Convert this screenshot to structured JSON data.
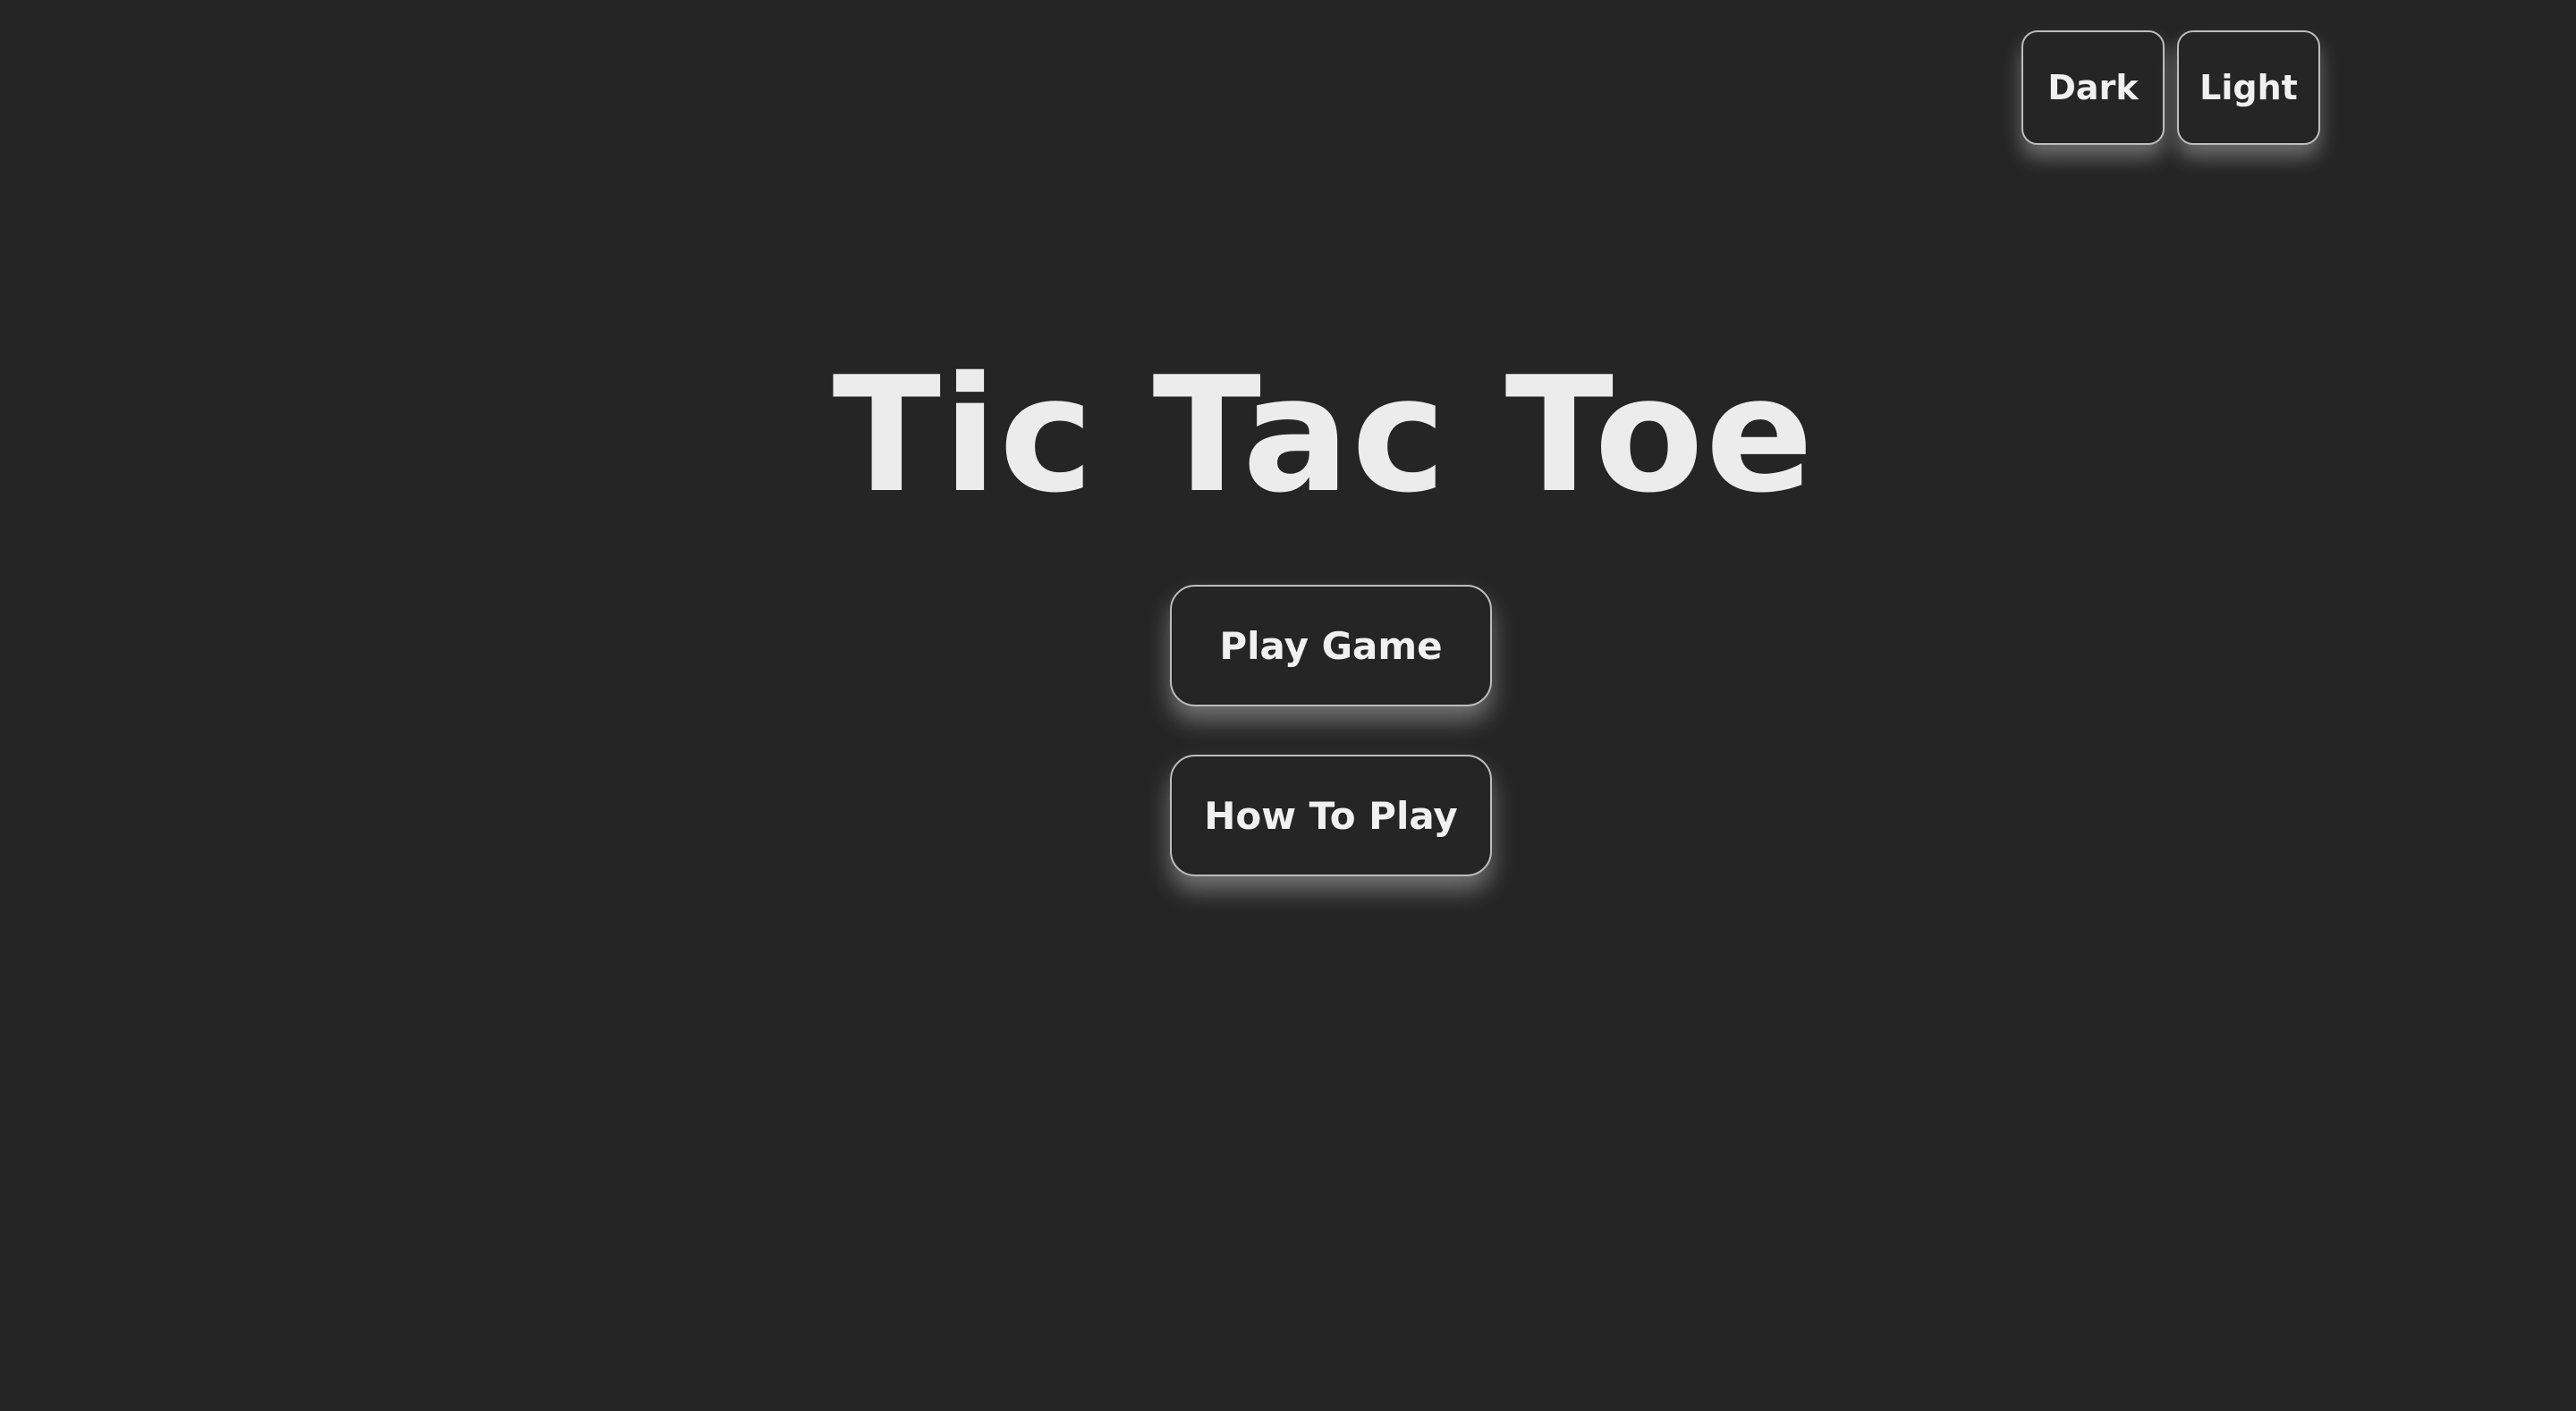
{
  "theme_toggle": {
    "dark_label": "Dark",
    "light_label": "Light"
  },
  "title": "Tic Tac Toe",
  "menu": {
    "play_label": "Play Game",
    "how_to_label": "How To Play"
  },
  "colors": {
    "background": "#252525",
    "text": "#ececec",
    "border": "#bdbdbd"
  }
}
